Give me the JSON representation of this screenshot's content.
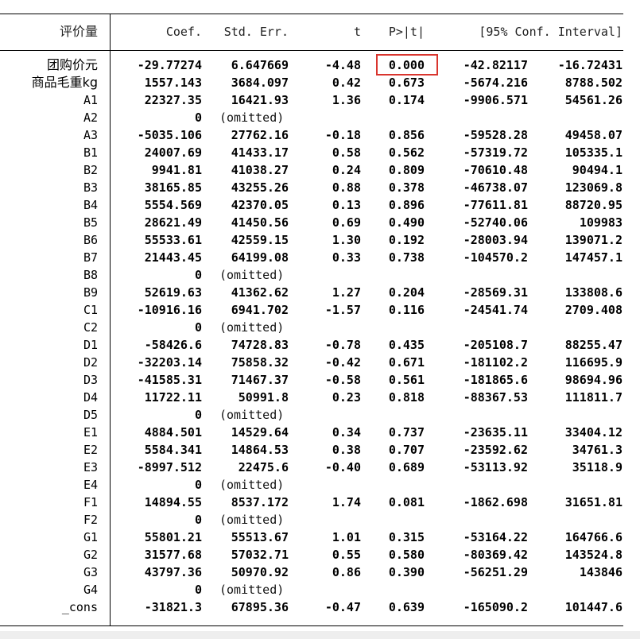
{
  "colors": {
    "highlight": "#d9352e",
    "rule": "#000000",
    "bottom_strip": "#eeeeee"
  },
  "headers": {
    "name": "评价量",
    "coef": "Coef.",
    "se": "Std. Err.",
    "t": "t",
    "p": "P>|t|",
    "ci": "[95% Conf. Interval]"
  },
  "highlighted_cell": "rows.0.p",
  "rows": [
    {
      "name": "团购价元",
      "coef": "-29.77274",
      "se": "6.647669",
      "t": "-4.48",
      "p": "0.000",
      "lo": "-42.82117",
      "hi": "-16.72431"
    },
    {
      "name": "商品毛重kg",
      "coef": "1557.143",
      "se": "3684.097",
      "t": "0.42",
      "p": "0.673",
      "lo": "-5674.216",
      "hi": "8788.502"
    },
    {
      "name": "A1",
      "coef": "22327.35",
      "se": "16421.93",
      "t": "1.36",
      "p": "0.174",
      "lo": "-9906.571",
      "hi": "54561.26"
    },
    {
      "name": "A2",
      "coef": "0",
      "se": "(omitted)",
      "t": "",
      "p": "",
      "lo": "",
      "hi": ""
    },
    {
      "name": "A3",
      "coef": "-5035.106",
      "se": "27762.16",
      "t": "-0.18",
      "p": "0.856",
      "lo": "-59528.28",
      "hi": "49458.07"
    },
    {
      "name": "B1",
      "coef": "24007.69",
      "se": "41433.17",
      "t": "0.58",
      "p": "0.562",
      "lo": "-57319.72",
      "hi": "105335.1"
    },
    {
      "name": "B2",
      "coef": "9941.81",
      "se": "41038.27",
      "t": "0.24",
      "p": "0.809",
      "lo": "-70610.48",
      "hi": "90494.1"
    },
    {
      "name": "B3",
      "coef": "38165.85",
      "se": "43255.26",
      "t": "0.88",
      "p": "0.378",
      "lo": "-46738.07",
      "hi": "123069.8"
    },
    {
      "name": "B4",
      "coef": "5554.569",
      "se": "42370.05",
      "t": "0.13",
      "p": "0.896",
      "lo": "-77611.81",
      "hi": "88720.95"
    },
    {
      "name": "B5",
      "coef": "28621.49",
      "se": "41450.56",
      "t": "0.69",
      "p": "0.490",
      "lo": "-52740.06",
      "hi": "109983"
    },
    {
      "name": "B6",
      "coef": "55533.61",
      "se": "42559.15",
      "t": "1.30",
      "p": "0.192",
      "lo": "-28003.94",
      "hi": "139071.2"
    },
    {
      "name": "B7",
      "coef": "21443.45",
      "se": "64199.08",
      "t": "0.33",
      "p": "0.738",
      "lo": "-104570.2",
      "hi": "147457.1"
    },
    {
      "name": "B8",
      "coef": "0",
      "se": "(omitted)",
      "t": "",
      "p": "",
      "lo": "",
      "hi": ""
    },
    {
      "name": "B9",
      "coef": "52619.63",
      "se": "41362.62",
      "t": "1.27",
      "p": "0.204",
      "lo": "-28569.31",
      "hi": "133808.6"
    },
    {
      "name": "C1",
      "coef": "-10916.16",
      "se": "6941.702",
      "t": "-1.57",
      "p": "0.116",
      "lo": "-24541.74",
      "hi": "2709.408"
    },
    {
      "name": "C2",
      "coef": "0",
      "se": "(omitted)",
      "t": "",
      "p": "",
      "lo": "",
      "hi": ""
    },
    {
      "name": "D1",
      "coef": "-58426.6",
      "se": "74728.83",
      "t": "-0.78",
      "p": "0.435",
      "lo": "-205108.7",
      "hi": "88255.47"
    },
    {
      "name": "D2",
      "coef": "-32203.14",
      "se": "75858.32",
      "t": "-0.42",
      "p": "0.671",
      "lo": "-181102.2",
      "hi": "116695.9"
    },
    {
      "name": "D3",
      "coef": "-41585.31",
      "se": "71467.37",
      "t": "-0.58",
      "p": "0.561",
      "lo": "-181865.6",
      "hi": "98694.96"
    },
    {
      "name": "D4",
      "coef": "11722.11",
      "se": "50991.8",
      "t": "0.23",
      "p": "0.818",
      "lo": "-88367.53",
      "hi": "111811.7"
    },
    {
      "name": "D5",
      "coef": "0",
      "se": "(omitted)",
      "t": "",
      "p": "",
      "lo": "",
      "hi": ""
    },
    {
      "name": "E1",
      "coef": "4884.501",
      "se": "14529.64",
      "t": "0.34",
      "p": "0.737",
      "lo": "-23635.11",
      "hi": "33404.12"
    },
    {
      "name": "E2",
      "coef": "5584.341",
      "se": "14864.53",
      "t": "0.38",
      "p": "0.707",
      "lo": "-23592.62",
      "hi": "34761.3"
    },
    {
      "name": "E3",
      "coef": "-8997.512",
      "se": "22475.6",
      "t": "-0.40",
      "p": "0.689",
      "lo": "-53113.92",
      "hi": "35118.9"
    },
    {
      "name": "E4",
      "coef": "0",
      "se": "(omitted)",
      "t": "",
      "p": "",
      "lo": "",
      "hi": ""
    },
    {
      "name": "F1",
      "coef": "14894.55",
      "se": "8537.172",
      "t": "1.74",
      "p": "0.081",
      "lo": "-1862.698",
      "hi": "31651.81"
    },
    {
      "name": "F2",
      "coef": "0",
      "se": "(omitted)",
      "t": "",
      "p": "",
      "lo": "",
      "hi": ""
    },
    {
      "name": "G1",
      "coef": "55801.21",
      "se": "55513.67",
      "t": "1.01",
      "p": "0.315",
      "lo": "-53164.22",
      "hi": "164766.6"
    },
    {
      "name": "G2",
      "coef": "31577.68",
      "se": "57032.71",
      "t": "0.55",
      "p": "0.580",
      "lo": "-80369.42",
      "hi": "143524.8"
    },
    {
      "name": "G3",
      "coef": "43797.36",
      "se": "50970.92",
      "t": "0.86",
      "p": "0.390",
      "lo": "-56251.29",
      "hi": "143846"
    },
    {
      "name": "G4",
      "coef": "0",
      "se": "(omitted)",
      "t": "",
      "p": "",
      "lo": "",
      "hi": ""
    },
    {
      "name": "_cons",
      "coef": "-31821.3",
      "se": "67895.36",
      "t": "-0.47",
      "p": "0.639",
      "lo": "-165090.2",
      "hi": "101447.6"
    }
  ]
}
